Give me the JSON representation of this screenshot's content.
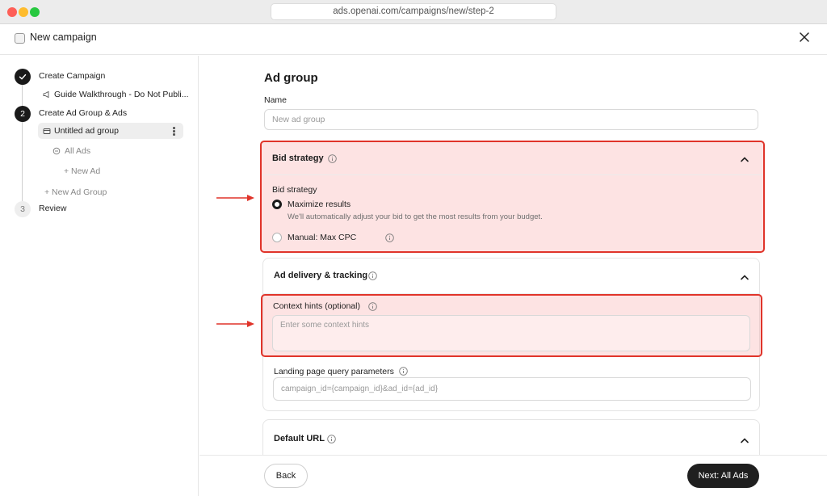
{
  "browser": {
    "url": "ads.openai.com/campaigns/new/step-2"
  },
  "header": {
    "title": "New campaign",
    "icon": "megaphone-icon",
    "close_icon": "close-icon"
  },
  "sidebar": {
    "steps": [
      {
        "number": "✓",
        "label": "Create Campaign",
        "state": "complete"
      },
      {
        "number": "2",
        "label": "Create Ad Group & Ads",
        "state": "current"
      },
      {
        "number": "3",
        "label": "Review",
        "state": "upcoming"
      }
    ],
    "campaign_item": "Guide Walkthrough - Do Not Publi...",
    "ad_group_item": "Untitled ad group",
    "all_ads": "All Ads",
    "new_ad": "+ New Ad",
    "new_ad_group": "+   New Ad Group"
  },
  "main": {
    "title": "Ad group",
    "name_label": "Name",
    "name_placeholder": "New ad group",
    "bid_section": {
      "title": "Bid strategy",
      "field_label": "Bid strategy",
      "options": [
        {
          "label": "Maximize results",
          "description": "We'll automatically adjust your bid to get the most results from your budget.",
          "selected": true
        },
        {
          "label": "Manual: Max CPC",
          "description": "",
          "selected": false
        }
      ]
    },
    "delivery_section": {
      "title": "Ad delivery & tracking",
      "context_label": "Context hints (optional)",
      "context_placeholder": "Enter some context hints",
      "query_label": "Landing page query parameters",
      "query_placeholder": "campaign_id={campaign_id}&ad_id={ad_id}"
    },
    "default_url_section": {
      "title": "Default URL"
    }
  },
  "footer": {
    "back_label": "Back",
    "next_label": "Next: All Ads"
  },
  "colors": {
    "highlight_border": "#e0342a",
    "highlight_fill": "#fbd5d5",
    "primary_button": "#1f1f1f"
  }
}
